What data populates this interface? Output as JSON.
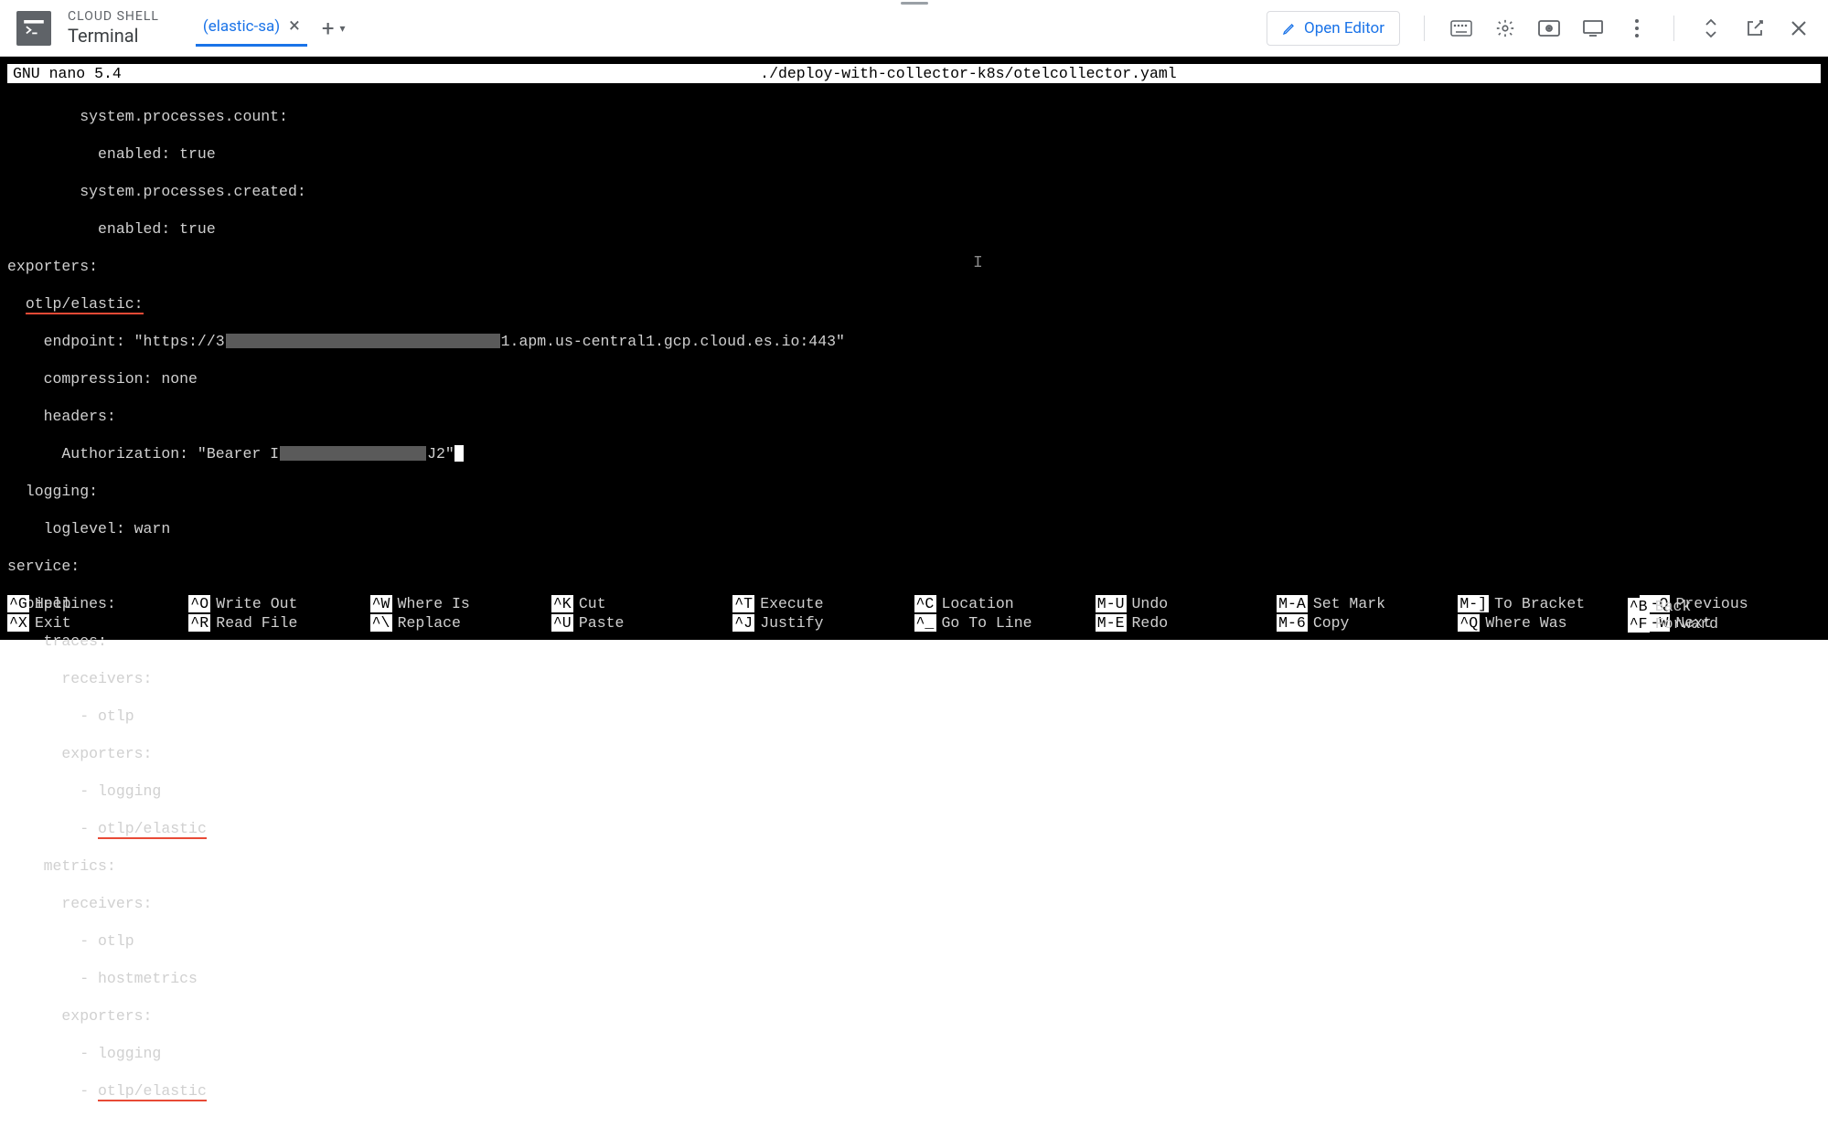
{
  "header": {
    "title_small": "CLOUD SHELL",
    "title_big": "Terminal",
    "tab_label": "(elastic-sa)",
    "open_editor": "Open Editor"
  },
  "nano": {
    "app": "GNU nano 5.4",
    "file": "./deploy-with-collector-k8s/otelcollector.yaml"
  },
  "yaml": {
    "l1": "        system.processes.count:",
    "l2": "          enabled: true",
    "l3": "        system.processes.created:",
    "l4": "          enabled: true",
    "l5": "exporters:",
    "l6a": "  ",
    "l6b": "otlp/elastic:",
    "l7a": "    endpoint: \"https://3",
    "l7b": "1.apm.us-central1.gcp.cloud.es.io:443\"",
    "l8": "    compression: none",
    "l9": "    headers:",
    "l10a": "      Authorization: \"Bearer I",
    "l10b": "J2\"",
    "l11": "  logging:",
    "l12": "    loglevel: warn",
    "l13": "service:",
    "l14": "  pipelines:",
    "l15": "    traces:",
    "l16": "      receivers:",
    "l17": "        - otlp",
    "l18": "      exporters:",
    "l19": "        - logging",
    "l20a": "        - ",
    "l20b": "otlp/elastic",
    "l21": "    metrics:",
    "l22": "      receivers:",
    "l23": "        - otlp",
    "l24": "        - hostmetrics",
    "l25": "      exporters:",
    "l26": "        - logging",
    "l27a": "        - ",
    "l27b": "otlp/elastic"
  },
  "footer": {
    "r1": [
      {
        "k": "^G",
        "l": "Help"
      },
      {
        "k": "^O",
        "l": "Write Out"
      },
      {
        "k": "^W",
        "l": "Where Is"
      },
      {
        "k": "^K",
        "l": "Cut"
      },
      {
        "k": "^T",
        "l": "Execute"
      },
      {
        "k": "^C",
        "l": "Location"
      },
      {
        "k": "M-U",
        "l": "Undo"
      },
      {
        "k": "M-A",
        "l": "Set Mark"
      },
      {
        "k": "M-]",
        "l": "To Bracket"
      },
      {
        "k": "M-Q",
        "l": "Previous"
      }
    ],
    "r2": [
      {
        "k": "^X",
        "l": "Exit"
      },
      {
        "k": "^R",
        "l": "Read File"
      },
      {
        "k": "^\\",
        "l": "Replace"
      },
      {
        "k": "^U",
        "l": "Paste"
      },
      {
        "k": "^J",
        "l": "Justify"
      },
      {
        "k": "^_",
        "l": "Go To Line"
      },
      {
        "k": "M-E",
        "l": "Redo"
      },
      {
        "k": "M-6",
        "l": "Copy"
      },
      {
        "k": "^Q",
        "l": "Where Was"
      },
      {
        "k": "M-W",
        "l": "Next"
      }
    ],
    "extra1": {
      "k": "^B",
      "l": "Back"
    },
    "extra2": {
      "k": "^F",
      "l": "Forward"
    }
  }
}
